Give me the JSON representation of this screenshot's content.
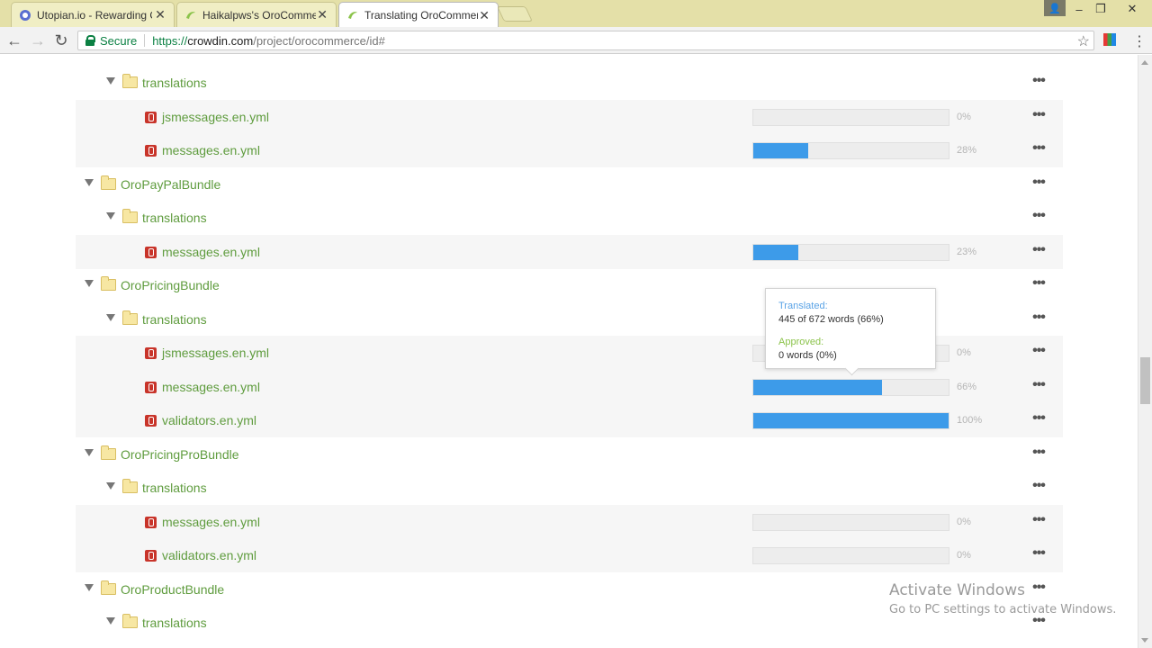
{
  "browser": {
    "tabs": [
      {
        "title": "Utopian.io - Rewarding O",
        "icon": "utopian-logo-icon"
      },
      {
        "title": "Haikalpws's OroCommer",
        "icon": "crowdin-logo-icon"
      },
      {
        "title": "Translating OroCommerc",
        "icon": "crowdin-logo-icon",
        "active": true
      }
    ],
    "tab_close": "✕",
    "controls": {
      "minimize": "–",
      "restore": "❐",
      "close": "✕",
      "user": "👤"
    },
    "toolbar": {
      "back": "←",
      "forward": "→",
      "reload": "↻",
      "bookmark": "☆",
      "menu": "⋮"
    },
    "omnibox": {
      "secure_label": "Secure",
      "scheme": "https://",
      "host": "crowdin.com",
      "path": "/project/orocommerce/id#"
    }
  },
  "colors": {
    "accent_link": "#5f9c3e",
    "progress_fill": "#3d9be9",
    "file_icon": "#c8342a"
  },
  "more_label": "•••",
  "tree": [
    {
      "type": "folder",
      "level": 1,
      "name": "translations"
    },
    {
      "type": "file",
      "name": "jsmessages.en.yml",
      "percent_label": "0%",
      "progress": 0
    },
    {
      "type": "file",
      "name": "messages.en.yml",
      "percent_label": "28%",
      "progress": 28
    },
    {
      "type": "folder",
      "level": 0,
      "name": "OroPayPalBundle"
    },
    {
      "type": "folder",
      "level": 1,
      "name": "translations"
    },
    {
      "type": "file",
      "name": "messages.en.yml",
      "percent_label": "23%",
      "progress": 23
    },
    {
      "type": "folder",
      "level": 0,
      "name": "OroPricingBundle"
    },
    {
      "type": "folder",
      "level": 1,
      "name": "translations"
    },
    {
      "type": "file",
      "name": "jsmessages.en.yml",
      "percent_label": "0%",
      "progress": 0
    },
    {
      "type": "file",
      "name": "messages.en.yml",
      "percent_label": "66%",
      "progress": 66
    },
    {
      "type": "file",
      "name": "validators.en.yml",
      "percent_label": "100%",
      "progress": 100
    },
    {
      "type": "folder",
      "level": 0,
      "name": "OroPricingProBundle"
    },
    {
      "type": "folder",
      "level": 1,
      "name": "translations"
    },
    {
      "type": "file",
      "name": "messages.en.yml",
      "percent_label": "0%",
      "progress": 0
    },
    {
      "type": "file",
      "name": "validators.en.yml",
      "percent_label": "0%",
      "progress": 0
    },
    {
      "type": "folder",
      "level": 0,
      "name": "OroProductBundle"
    },
    {
      "type": "folder",
      "level": 1,
      "name": "translations"
    }
  ],
  "tooltip": {
    "translated_label": "Translated:",
    "translated_value": "445 of 672 words (66%)",
    "approved_label": "Approved:",
    "approved_value": "0 words (0%)"
  },
  "watermark": {
    "title": "Activate Windows",
    "subtitle": "Go to PC settings to activate Windows."
  }
}
